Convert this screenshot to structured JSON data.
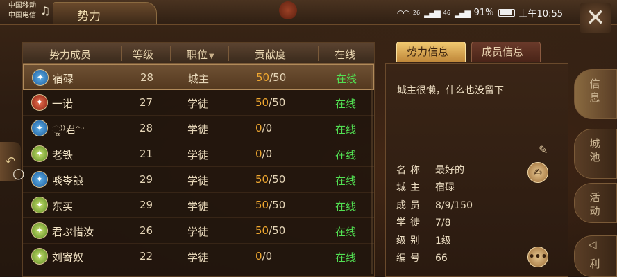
{
  "status": {
    "carrier1": "中国移动",
    "carrier2": "中国电信",
    "net1": "26",
    "net2": "46",
    "battery": "91%",
    "time": "上午10:55"
  },
  "window": {
    "title": "势力",
    "close_icon": "close-icon"
  },
  "table": {
    "headers": {
      "member": "势力成员",
      "level": "等级",
      "position": "职位",
      "contribution": "贡献度",
      "online": "在线"
    },
    "rows": [
      {
        "name": "宿碌",
        "level": "28",
        "position": "城主",
        "cur": "50",
        "max": "/50",
        "status": "在线",
        "avatar": "blue"
      },
      {
        "name": "一诺",
        "level": "27",
        "position": "学徒",
        "cur": "50",
        "max": "/50",
        "status": "在线",
        "avatar": "red"
      },
      {
        "name": "ૢ⁾⁾君ᵔᵕ",
        "level": "28",
        "position": "学徒",
        "cur": "0",
        "max": "/0",
        "status": "在线",
        "avatar": "blue"
      },
      {
        "name": "老铁",
        "level": "21",
        "position": "学徒",
        "cur": "0",
        "max": "/0",
        "status": "在线",
        "avatar": "green"
      },
      {
        "name": "啖岺誏",
        "level": "29",
        "position": "学徒",
        "cur": "50",
        "max": "/50",
        "status": "在线",
        "avatar": "blue"
      },
      {
        "name": "东买",
        "level": "29",
        "position": "学徒",
        "cur": "50",
        "max": "/50",
        "status": "在线",
        "avatar": "green"
      },
      {
        "name": "君ぷ惜汝",
        "level": "26",
        "position": "学徒",
        "cur": "50",
        "max": "/50",
        "status": "在线",
        "avatar": "green"
      },
      {
        "name": "刘寄奴",
        "level": "22",
        "position": "学徒",
        "cur": "0",
        "max": "/0",
        "status": "在线",
        "avatar": "green"
      }
    ]
  },
  "tabs": {
    "faction_info": "势力信息",
    "member_info": "成员信息"
  },
  "info": {
    "announcement": "城主很懒，什么也没留下",
    "name_label": "名称",
    "name_value": "最好的",
    "lord_label": "城主",
    "lord_value": "宿碌",
    "members_label": "成员",
    "members_value": "8/9/150",
    "apprentice_label": "学徒",
    "apprentice_value": "7/8",
    "grade_label": "级别",
    "grade_value": "1级",
    "number_label": "编号",
    "number_value": "66"
  },
  "side_menu": {
    "item1": "信息",
    "item2": "城池",
    "item3": "活动",
    "item4": "利"
  }
}
